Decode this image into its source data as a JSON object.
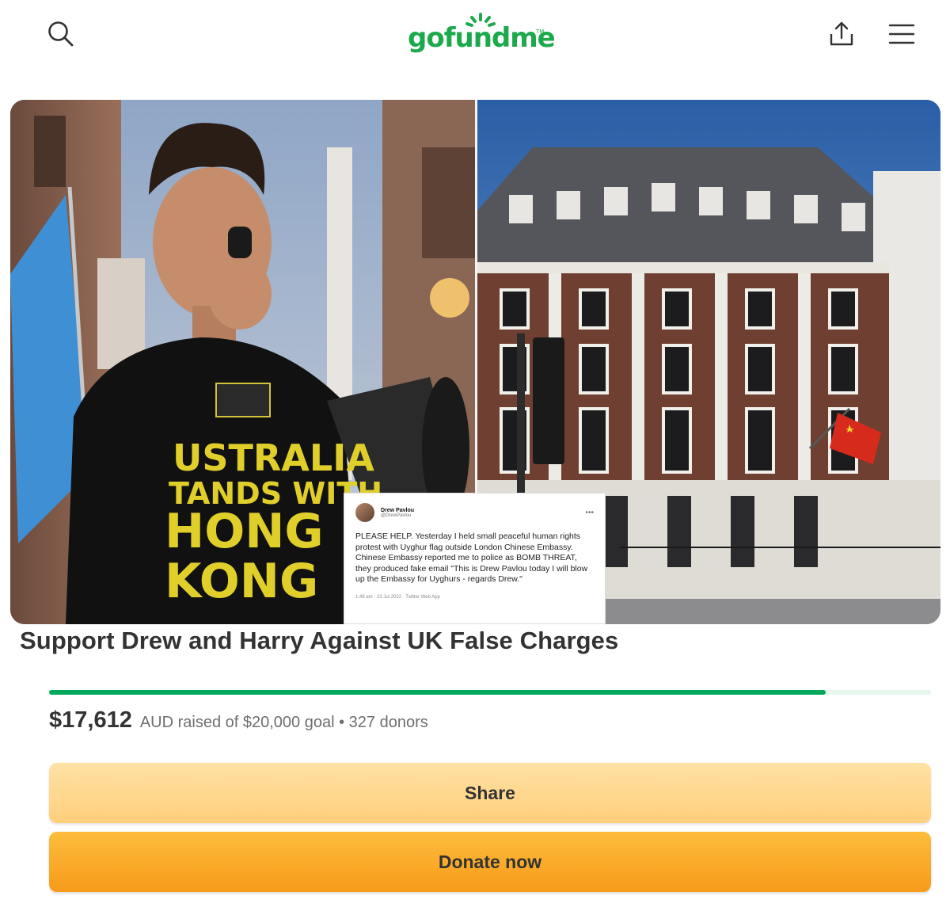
{
  "header": {
    "logo_text": "gofundme",
    "logo_tm": "TM",
    "icons": {
      "search": "search-icon",
      "share": "share-upload-icon",
      "menu": "hamburger-menu-icon"
    },
    "brand_color": "#1ba94c"
  },
  "hero": {
    "left_photo_alt": "Drew Pavlou speaking into a megaphone wearing an AUSTRALIA STANDS WITH HONG KONG shirt",
    "right_photo_alt": "Chinese Embassy building in London",
    "shirt_text": [
      "USTRALIA",
      "TANDS WITH",
      "HONG",
      "KONG"
    ],
    "tweet": {
      "name": "Drew Pavlou",
      "handle": "@DrewPavlou",
      "body": "PLEASE HELP. Yesterday I held small peaceful human rights protest with Uyghur flag outside London Chinese Embassy. Chinese Embassy reported me to police as BOMB THREAT, they produced fake email \"This is Drew Pavlou today I will blow up the Embassy for Uyghurs - regards Drew.\"",
      "meta": "1:49 am · 23 Jul 2022 · Twitter Web App"
    }
  },
  "campaign": {
    "title": "Support Drew and Harry Against UK False Charges",
    "raised_amount": "$17,612",
    "raised_detail": "AUD raised of $20,000 goal • 327 donors",
    "progress_fraction": 0.8806,
    "progress_color": "#02a95c"
  },
  "actions": {
    "share_label": "Share",
    "donate_label": "Donate now"
  }
}
